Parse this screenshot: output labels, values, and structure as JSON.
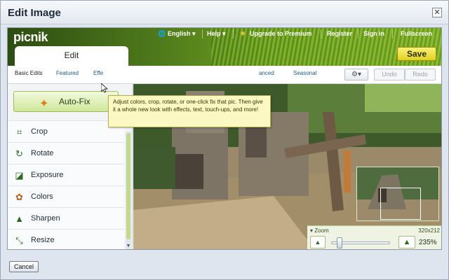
{
  "dialog": {
    "title": "Edit Image",
    "close_icon": "close-icon"
  },
  "app": {
    "logo": "picnik",
    "top_nav": {
      "language": "English ▾",
      "help": "Help ▾",
      "upgrade": "Upgrade to Premium",
      "register": "Register",
      "sign_in": "Sign in",
      "fullscreen": "Fullscreen"
    },
    "save_label": "Save",
    "edit_tab": "Edit",
    "subtabs": [
      "Basic Edits",
      "Featured",
      "Effe",
      "anced",
      "Seasonal"
    ],
    "toolbar": {
      "gear_label": "⚙▾",
      "undo": "Undo",
      "redo": "Redo"
    },
    "tooltip": "Adjust colors, crop, rotate, or one-click fix that pic. Then give it a whole new look with effects, text, touch-ups, and more!",
    "autofix_label": "Auto-Fix",
    "tools": [
      {
        "label": "Crop",
        "icon": "crop-icon"
      },
      {
        "label": "Rotate",
        "icon": "rotate-icon"
      },
      {
        "label": "Exposure",
        "icon": "exposure-icon"
      },
      {
        "label": "Colors",
        "icon": "colors-icon"
      },
      {
        "label": "Sharpen",
        "icon": "sharpen-icon"
      },
      {
        "label": "Resize",
        "icon": "resize-icon"
      }
    ],
    "zoom": {
      "label": "▾ Zoom",
      "dimensions": "320x212",
      "percent": "235%"
    }
  },
  "footer": {
    "cancel_label": "Cancel"
  },
  "colors": {
    "accent_green": "#c3d98e",
    "save_yellow": "#e1d21f",
    "link_blue": "#1d5a8a"
  }
}
